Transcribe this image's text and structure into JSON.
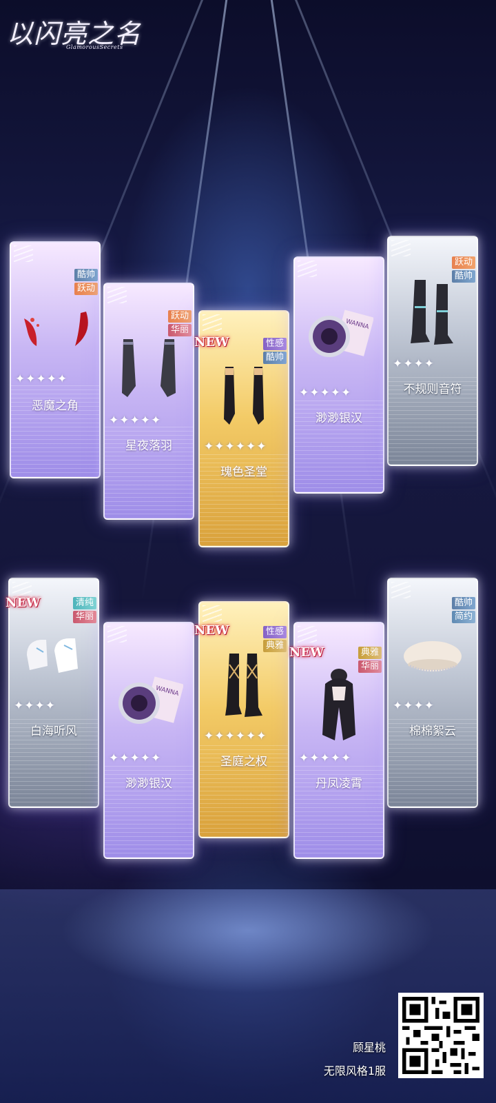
{
  "logo": {
    "title": "以闪亮之名",
    "subtitle": "GlamorousSecrets"
  },
  "new_badge": "NEW",
  "row1": [
    {
      "name": "恶魔之角",
      "tags": [
        "酷帅",
        "跃动"
      ],
      "stars": "✦✦✦✦✦",
      "theme": "purple",
      "item_icon": "devil-horns-icon",
      "is_new": false
    },
    {
      "name": "星夜落羽",
      "tags": [
        "跃动",
        "华丽"
      ],
      "stars": "✦✦✦✦✦",
      "theme": "purple",
      "item_icon": "black-gloves-icon",
      "is_new": false
    },
    {
      "name": "瑰色圣堂",
      "tags": [
        "性感",
        "酷帅"
      ],
      "stars": "✦✦✦✦✦✦",
      "theme": "gold",
      "item_icon": "black-gloves-icon",
      "is_new": true
    },
    {
      "name": "渺渺银汉",
      "tags": [],
      "stars": "✦✦✦✦✦",
      "theme": "purple",
      "item_icon": "eye-lens-icon",
      "is_new": false
    },
    {
      "name": "不规则音符",
      "tags": [
        "跃动",
        "酷帅"
      ],
      "stars": "✦✦✦✦",
      "theme": "silver",
      "item_icon": "boots-icon",
      "is_new": false
    }
  ],
  "row2": [
    {
      "name": "白海听风",
      "tags": [
        "清纯",
        "华丽"
      ],
      "stars": "✦✦✦✦",
      "theme": "silver",
      "item_icon": "white-shoes-icon",
      "is_new": true
    },
    {
      "name": "渺渺银汉",
      "tags": [],
      "stars": "✦✦✦✦✦",
      "theme": "purple",
      "item_icon": "eye-lens-icon",
      "is_new": false
    },
    {
      "name": "圣庭之权",
      "tags": [
        "性感",
        "典雅"
      ],
      "stars": "✦✦✦✦✦✦",
      "theme": "gold",
      "item_icon": "boots-icon",
      "is_new": true
    },
    {
      "name": "丹凤凌霄",
      "tags": [
        "典雅",
        "华丽"
      ],
      "stars": "✦✦✦✦✦",
      "theme": "purple",
      "item_icon": "hair-icon",
      "is_new": true
    },
    {
      "name": "棉棉絮云",
      "tags": [
        "酷帅",
        "简约"
      ],
      "stars": "✦✦✦✦",
      "theme": "silver",
      "item_icon": "beret-icon",
      "is_new": false
    }
  ],
  "credit": {
    "author": "顾星桃",
    "server": "无限风格1服"
  },
  "colors": {
    "purple_card": "#c8b6f4",
    "gold_card": "#f3cb67",
    "silver_card": "#c2c9d6",
    "new_red": "#d21a3a"
  }
}
